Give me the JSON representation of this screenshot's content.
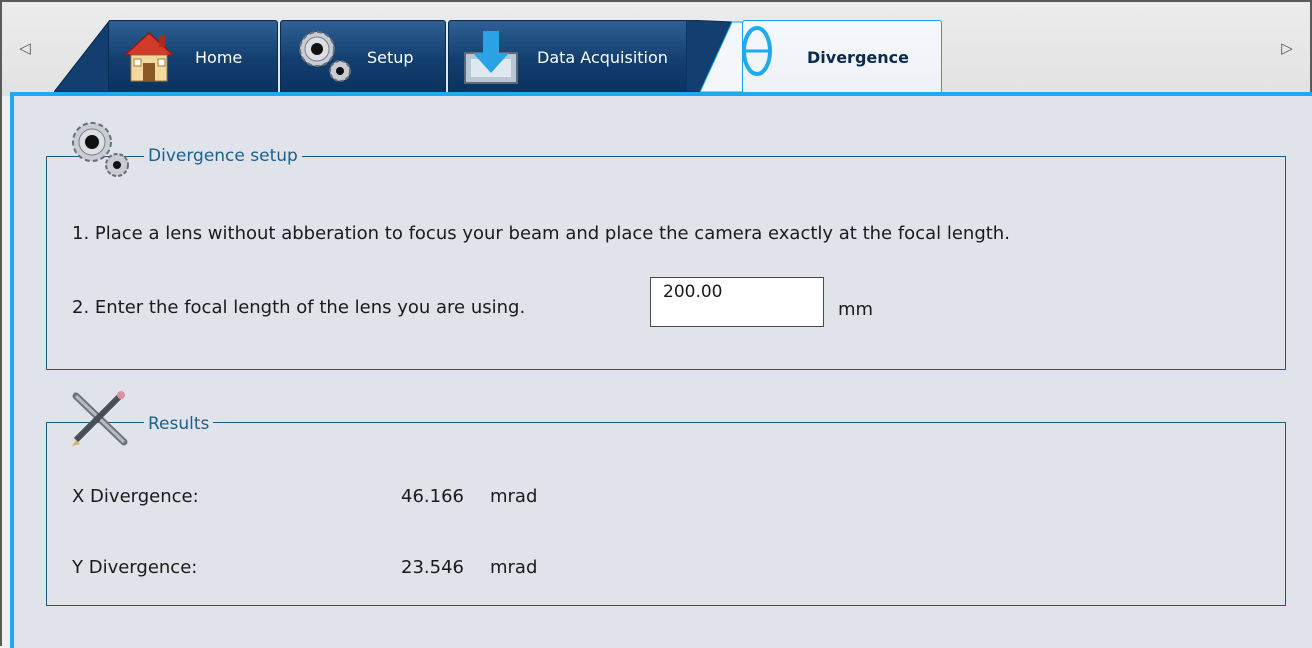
{
  "tabs": [
    {
      "label": "Home",
      "icon": "home-icon"
    },
    {
      "label": "Setup",
      "icon": "gears-icon"
    },
    {
      "label": "Data Acquisition",
      "icon": "download-icon"
    },
    {
      "label": "Divergence",
      "icon": "theta-icon",
      "active": true
    }
  ],
  "tab_scroll": {
    "left": "◁",
    "right": "▷"
  },
  "divergence_setup": {
    "title": "Divergence setup",
    "step1": "1. Place a lens without abberation to focus your beam and place the camera exactly at the focal length.",
    "step2": "2. Enter the focal length of the lens you are using.",
    "focal_length_value": "200.00",
    "focal_length_unit": "mm"
  },
  "results": {
    "title": "Results",
    "rows": [
      {
        "label": "X Divergence:",
        "value": "46.166",
        "unit": "mrad"
      },
      {
        "label": "Y Divergence:",
        "value": "23.546",
        "unit": "mrad"
      }
    ]
  },
  "colors": {
    "tab_blue": "#123f6f",
    "accent_cyan": "#1daaf0",
    "group_title": "#1b5f8c",
    "panel_bg": "#e0e3ea"
  }
}
